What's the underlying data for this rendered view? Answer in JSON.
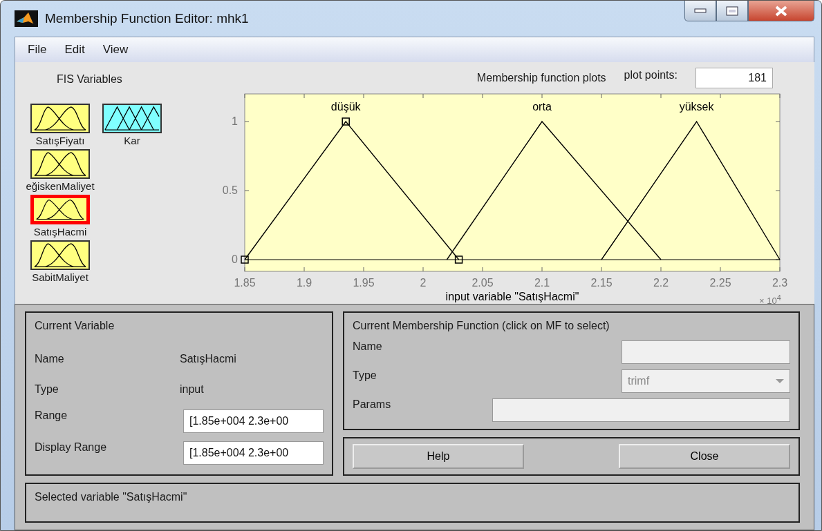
{
  "window": {
    "title": "Membership Function Editor: mhk1"
  },
  "menu": [
    "File",
    "Edit",
    "View"
  ],
  "fis_variables": {
    "title": "FIS Variables",
    "items": [
      {
        "name": "SatışFiyatı",
        "kind": "input",
        "selected": false
      },
      {
        "name": "Kar",
        "kind": "output",
        "selected": false
      },
      {
        "name": "eğiskenMaliyet",
        "kind": "input",
        "selected": false
      },
      {
        "name": "SatışHacmi",
        "kind": "input",
        "selected": true
      },
      {
        "name": "SabitMaliyet",
        "kind": "input",
        "selected": false
      }
    ]
  },
  "plot": {
    "title": "Membership function plots",
    "plot_points_label": "plot points:",
    "plot_points": "181",
    "axis_multiplier": "× 10$^{4}$",
    "chart_data": {
      "type": "line",
      "xlabel": "input variable \"SatışHacmi\"",
      "x": [
        1.85,
        1.935,
        2.02,
        2.03,
        2.1,
        2.15,
        2.2,
        2.23,
        2.3
      ],
      "series": [
        {
          "name": "düşük",
          "color": "#000000",
          "marker": "square",
          "values": [
            0,
            1,
            null,
            0,
            null,
            null,
            null,
            null,
            null
          ]
        },
        {
          "name": "orta",
          "color": "#000000",
          "values": [
            null,
            null,
            0,
            null,
            1,
            null,
            0,
            null,
            null
          ]
        },
        {
          "name": "yüksek",
          "color": "#000000",
          "values": [
            null,
            null,
            null,
            null,
            null,
            0,
            null,
            1,
            0
          ]
        }
      ],
      "xlim": [
        1.85,
        2.3
      ],
      "ylim": [
        -0.085,
        1.2
      ],
      "xticks": [
        1.85,
        1.9,
        1.95,
        {
          "value": 2,
          "label": "2"
        },
        2.05,
        {
          "value": 2.1,
          "label": "2.1"
        },
        2.15,
        {
          "value": 2.2,
          "label": "2.2"
        },
        2.25,
        {
          "value": 2.3,
          "label": "2.3"
        }
      ],
      "yticks": [
        0,
        0.5,
        1
      ]
    }
  },
  "current_variable": {
    "title": "Current Variable",
    "name_label": "Name",
    "name": "SatışHacmi",
    "type_label": "Type",
    "type": "input",
    "range_label": "Range",
    "range": "[1.85e+004 2.3e+00",
    "display_range_label": "Display Range",
    "display_range": "[1.85e+004 2.3e+00"
  },
  "current_mf": {
    "title": "Current Membership Function (click on MF to select)",
    "name_label": "Name",
    "type_label": "Type",
    "type": "trimf",
    "type_disabled": true,
    "params_label": "Params"
  },
  "buttons": [
    "Help",
    "Close"
  ],
  "status": "Selected variable \"SatışHacmi\""
}
